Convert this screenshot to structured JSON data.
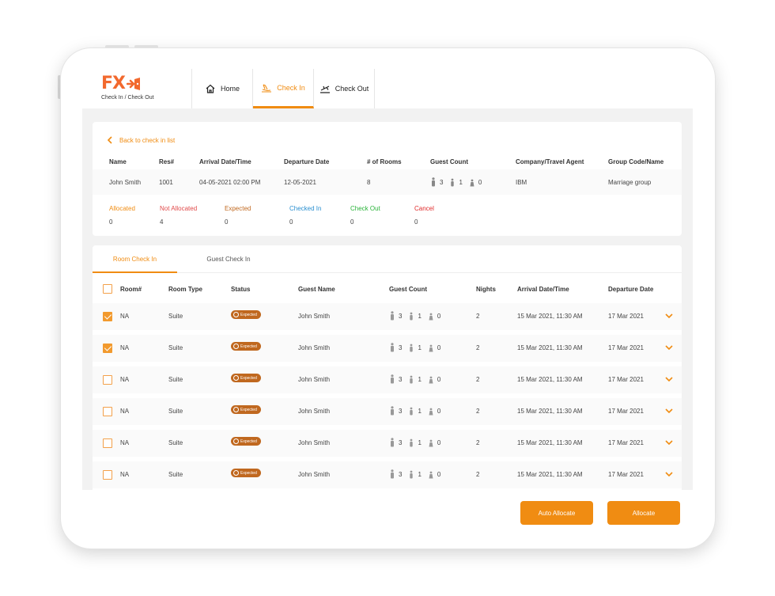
{
  "brand": {
    "logo_text": "FX",
    "subtitle": "Check In / Check Out",
    "color": "#f2692e"
  },
  "accent": "#f08c12",
  "nav": {
    "tabs": [
      {
        "label": "Home",
        "icon": "home-icon"
      },
      {
        "label": "Check In",
        "icon": "check-in-icon",
        "active": true
      },
      {
        "label": "Check Out",
        "icon": "check-out-icon"
      }
    ]
  },
  "summary": {
    "back_label": "Back to check in list",
    "headers": [
      "Name",
      "Res#",
      "Arrival Date/Time",
      "Departure Date",
      "# of Rooms",
      "Guest Count",
      "Company/Travel Agent",
      "Group Code/Name"
    ],
    "row": {
      "name": "John Smith",
      "res": "1001",
      "arrival": "04-05-2021 02:00 PM",
      "departure": "12-05-2021",
      "rooms": "8",
      "guest_adults": "3",
      "guest_children": "1",
      "guest_infants": "0",
      "company": "IBM",
      "group": "Marriage group"
    },
    "statuses": [
      {
        "label": "Allocated",
        "value": "0",
        "color": "#f08c12"
      },
      {
        "label": "Not Allocated",
        "value": "4",
        "color": "#e04a4a"
      },
      {
        "label": "Expected",
        "value": "0",
        "color": "#c0681f"
      },
      {
        "label": "Checked In",
        "value": "0",
        "color": "#2a8fd0"
      },
      {
        "label": "Check Out",
        "value": "0",
        "color": "#2bb33a"
      },
      {
        "label": "Cancel",
        "value": "0",
        "color": "#e02a2a"
      }
    ]
  },
  "rooms": {
    "tabs": [
      {
        "label": "Room Check In",
        "active": true
      },
      {
        "label": "Guest Check In"
      }
    ],
    "headers": [
      "Room#",
      "Room Type",
      "Status",
      "Guest Name",
      "Guest Count",
      "Nights",
      "Arrival Date/Time",
      "Departure Date"
    ],
    "rows": [
      {
        "checked": true,
        "room": "NA",
        "type": "Suite",
        "status": "Expected",
        "guest": "John Smith",
        "adults": "3",
        "children": "1",
        "infants": "0",
        "nights": "2",
        "arrival": "15 Mar 2021, 11:30 AM",
        "departure": "17 Mar 2021"
      },
      {
        "checked": true,
        "room": "NA",
        "type": "Suite",
        "status": "Expected",
        "guest": "John Smith",
        "adults": "3",
        "children": "1",
        "infants": "0",
        "nights": "2",
        "arrival": "15 Mar 2021, 11:30 AM",
        "departure": "17 Mar 2021"
      },
      {
        "checked": false,
        "room": "NA",
        "type": "Suite",
        "status": "Expected",
        "guest": "John Smith",
        "adults": "3",
        "children": "1",
        "infants": "0",
        "nights": "2",
        "arrival": "15 Mar 2021, 11:30 AM",
        "departure": "17 Mar 2021"
      },
      {
        "checked": false,
        "room": "NA",
        "type": "Suite",
        "status": "Expected",
        "guest": "John Smith",
        "adults": "3",
        "children": "1",
        "infants": "0",
        "nights": "2",
        "arrival": "15 Mar 2021, 11:30 AM",
        "departure": "17 Mar 2021"
      },
      {
        "checked": false,
        "room": "NA",
        "type": "Suite",
        "status": "Expected",
        "guest": "John Smith",
        "adults": "3",
        "children": "1",
        "infants": "0",
        "nights": "2",
        "arrival": "15 Mar 2021, 11:30 AM",
        "departure": "17 Mar 2021"
      },
      {
        "checked": false,
        "room": "NA",
        "type": "Suite",
        "status": "Expected",
        "guest": "John Smith",
        "adults": "3",
        "children": "1",
        "infants": "0",
        "nights": "2",
        "arrival": "15 Mar 2021, 11:30 AM",
        "departure": "17 Mar 2021"
      }
    ]
  },
  "footer": {
    "auto_allocate_label": "Auto Allocate",
    "allocate_label": "Allocate"
  }
}
